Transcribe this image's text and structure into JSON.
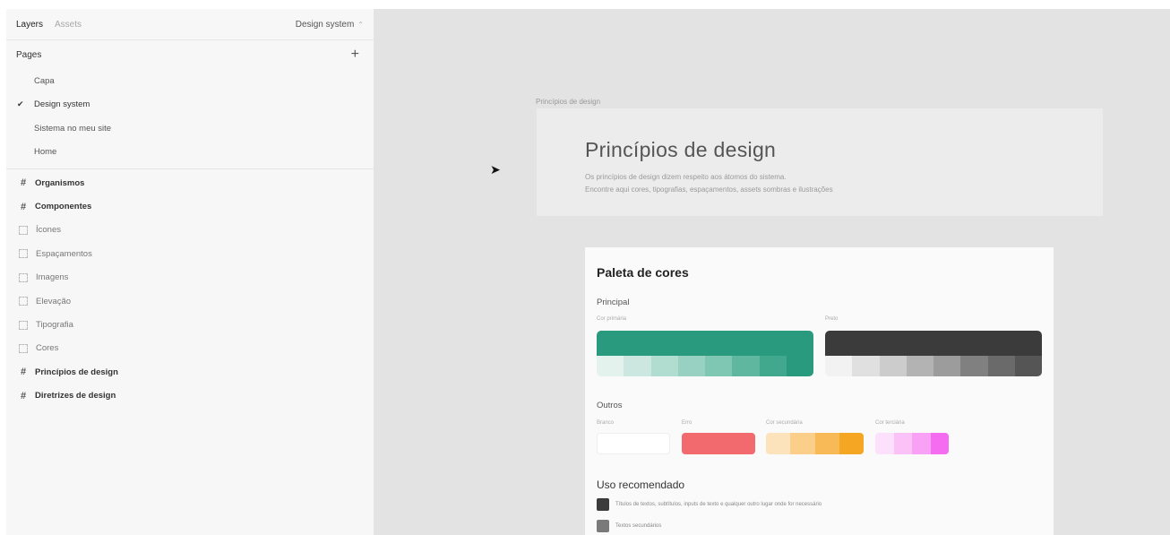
{
  "sidebar": {
    "tabs": {
      "layers": "Layers",
      "assets": "Assets"
    },
    "page_selector": {
      "label": "Design system",
      "icon": "chevron-up-icon"
    },
    "pages_header": {
      "label": "Pages",
      "add_icon": "+"
    },
    "check_glyph": "✔",
    "pages": [
      "Capa",
      "Design system",
      "Sistema no meu site",
      "Home"
    ],
    "current_page": "Design system",
    "frame_glyph": "#",
    "layers": [
      {
        "label": "Organismos",
        "kind": "frame"
      },
      {
        "label": "Componentes",
        "kind": "frame"
      },
      {
        "label": "Ícones",
        "kind": "section"
      },
      {
        "label": "Espaçamentos",
        "kind": "section"
      },
      {
        "label": "Imagens",
        "kind": "section"
      },
      {
        "label": "Elevação",
        "kind": "section"
      },
      {
        "label": "Tipografia",
        "kind": "section"
      },
      {
        "label": "Cores",
        "kind": "section"
      },
      {
        "label": "Princípios de design",
        "kind": "frame"
      },
      {
        "label": "Diretrizes de design",
        "kind": "frame"
      }
    ]
  },
  "canvas": {
    "cursor_glyph": "➤",
    "frame1": {
      "label": "Princípios de design",
      "title": "Princípios de design",
      "desc_line1": "Os princípios de design dizem respeito aos átomos do sistema.",
      "desc_line2": "Encontre aqui cores, tipografias, espaçamentos, assets sombras e ilustrações"
    },
    "palette": {
      "title": "Paleta de cores",
      "principal": "Principal",
      "cor_primaria_label": "Cor primária",
      "preto_label": "Preto",
      "outros": "Outros",
      "branco_label": "Branco",
      "erro_label": "Erro",
      "cor_secundaria_label": "Cor secundária",
      "cor_terciaria_label": "Cor terciária",
      "colors": {
        "primary": "#2a9a7f",
        "black": "#3b3b3b",
        "error": "#f36a6e",
        "secondary": "#f5a623",
        "tertiary": "#f56cf0"
      },
      "primary_shades": [
        "#e4f2ee",
        "#cbe7df",
        "#b1dcd0",
        "#98d1c2",
        "#7fc6b3",
        "#5fb7a0",
        "#42a88d",
        "#2a9a7f"
      ],
      "black_shades": [
        "#f2f2f2",
        "#e0e0e0",
        "#cccccc",
        "#b3b3b3",
        "#9c9c9c",
        "#808080",
        "#6a6a6a",
        "#555555"
      ],
      "secondary_shades": [
        "#fde3bb",
        "#fbcf8a",
        "#f8ba56",
        "#f5a623"
      ],
      "tertiary_shades": [
        "#fde1fc",
        "#fbc2f8",
        "#f9a1f5",
        "#f56cf0"
      ]
    },
    "uso": {
      "title": "Uso recomendado",
      "rows": [
        {
          "text": "Títulos de textos, subtítulos, inputs de texto e qualquer outro lugar onde for necessário",
          "color": "#3b3b3b"
        },
        {
          "text": "Textos secundários",
          "color": "#7a7a7a"
        }
      ]
    }
  }
}
